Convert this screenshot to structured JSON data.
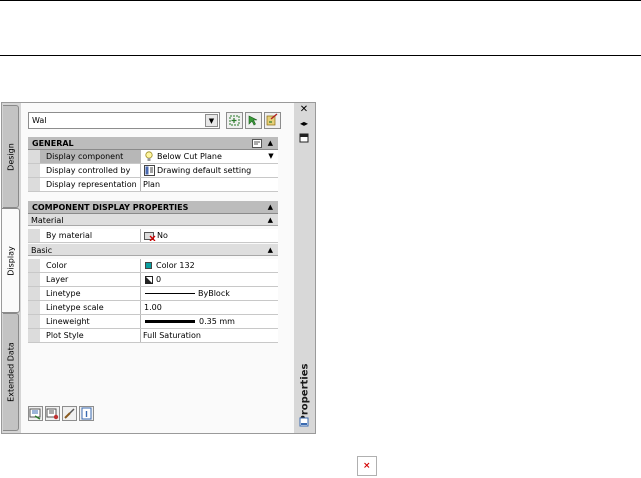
{
  "style_selector": {
    "value": "Wal"
  },
  "tabs": [
    {
      "label": "Design"
    },
    {
      "label": "Display"
    },
    {
      "label": "Extended Data"
    }
  ],
  "palette_title": "Properties",
  "general": {
    "header": "GENERAL",
    "rows": [
      {
        "key": "Display component",
        "value": "Below Cut Plane"
      },
      {
        "key": "Display controlled by",
        "value": "Drawing default setting"
      },
      {
        "key": "Display representation",
        "value": "Plan"
      }
    ]
  },
  "component": {
    "header": "COMPONENT DISPLAY PROPERTIES",
    "material": {
      "label": "Material",
      "rows": [
        {
          "key": "By material",
          "value": "No"
        }
      ]
    },
    "basic": {
      "label": "Basic",
      "rows": [
        {
          "key": "Color",
          "value": "Color 132"
        },
        {
          "key": "Layer",
          "value": "0"
        },
        {
          "key": "Linetype",
          "value": "ByBlock"
        },
        {
          "key": "Linetype scale",
          "value": "1.00"
        },
        {
          "key": "Lineweight",
          "value": "0.35 mm"
        },
        {
          "key": "Plot Style",
          "value": "Full Saturation"
        }
      ]
    }
  },
  "colors": {
    "color_132_swatch": "#0aa0a0",
    "selected_key_bg": "#b7b7b7"
  }
}
